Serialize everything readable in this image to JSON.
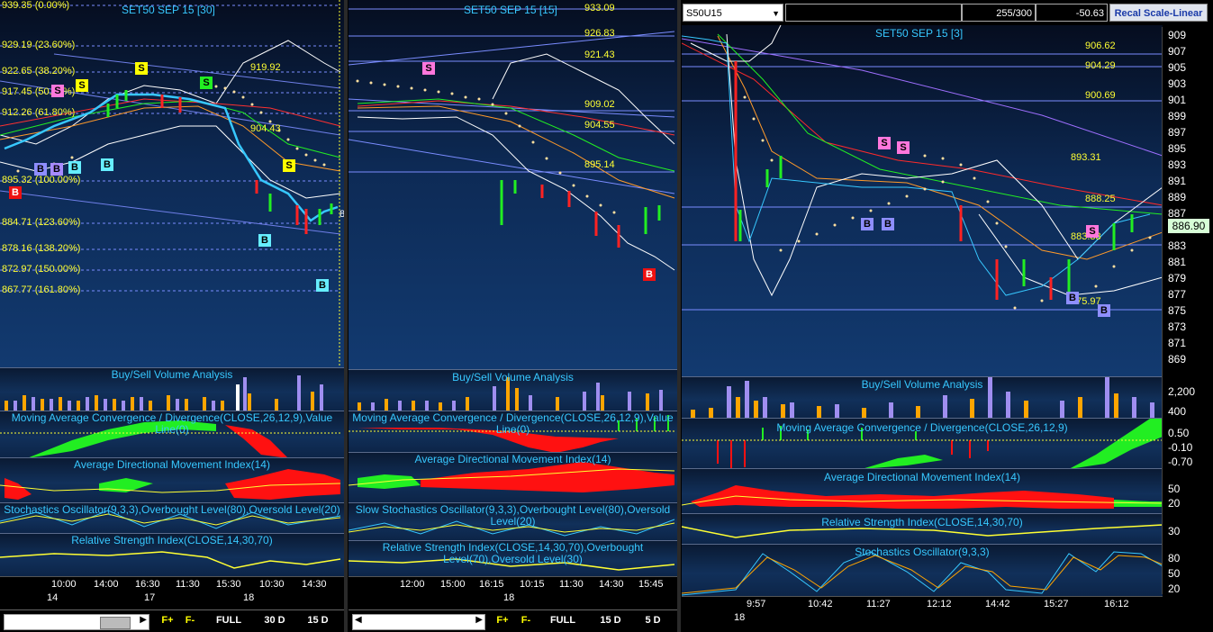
{
  "colors": {
    "accent": "#37c8ff",
    "level": "#ffff33",
    "bull": "#22ee22",
    "bear": "#ff1111",
    "volume_buy": "#ffa500",
    "volume_sell": "#9f8ef0"
  },
  "left": {
    "title": "SET50 SEP 15   [30]",
    "fib_levels": [
      "939.35 (0.00%)",
      "929.19 (23.60%)",
      "922.65 (38.20%)",
      "917.45 (50.00%)",
      "912.26 (61.80%)",
      "895.32 (100.00%)",
      "884.71 (123.60%)",
      "878.16 (138.20%)",
      "872.97 (150.00%)",
      "867.77 (161.80%)"
    ],
    "annotations": [
      "919.92",
      "904.43"
    ],
    "signals": [
      "S",
      "S",
      "S",
      "S",
      "B",
      "B",
      "B",
      "B",
      "B",
      "B",
      "B",
      "B",
      "S"
    ],
    "subcharts": [
      "Buy/Sell Volume Analysis",
      "Moving Average Convergence / Divergence(CLOSE,26,12,9),Value Line(0)",
      "Average Directional Movement Index(14)",
      "Stochastics Oscillator(9,3,3),Overbought Level(80),Oversold Level(20)",
      "Relative Strength Index(CLOSE,14,30,70)"
    ],
    "time_labels": [
      "10:00",
      "14:00",
      "16:30",
      "11:30",
      "15:30",
      "10:30",
      "14:30"
    ],
    "date_labels": [
      "14",
      "17",
      "18"
    ],
    "right_edge_label": "8",
    "bottom": {
      "fplus": "F+",
      "fminus": "F-",
      "full": "FULL",
      "r1": "30 D",
      "r2": "15 D"
    }
  },
  "mid": {
    "title": "SET50 SEP 15   [15]",
    "levels": [
      "933.09",
      "926.83",
      "921.43",
      "909.02",
      "904.55",
      "895.14"
    ],
    "signals": [
      "S",
      "B"
    ],
    "subcharts": [
      "Buy/Sell Volume Analysis",
      "Moving Average Convergence / Divergence(CLOSE,26,12,9),Value Line(0)",
      "Average Directional Movement Index(14)",
      "Slow Stochastics Oscillator(9,3,3),Overbought Level(80),Oversold Level(20)",
      "Relative Strength Index(CLOSE,14,30,70),Overbought Level(70),Oversold Level(30)"
    ],
    "time_labels": [
      "12:00",
      "15:00",
      "16:15",
      "10:15",
      "11:30",
      "14:30",
      "15:45"
    ],
    "date_labels": [
      "18"
    ],
    "bottom": {
      "fplus": "F+",
      "fminus": "F-",
      "full": "FULL",
      "r1": "15 D",
      "r2": "5 D"
    }
  },
  "right": {
    "symbol": "S50U15",
    "count": "255/300",
    "change": "-50.63",
    "scale_button": "Recal Scale-Linear",
    "title": "SET50 SEP 15   [3]",
    "levels": [
      "906.62",
      "904.29",
      "900.69",
      "893.31",
      "888.25",
      "883.33",
      "875.97"
    ],
    "last_price": "886.90",
    "price_axis": [
      "909",
      "907",
      "905",
      "903",
      "901",
      "899",
      "897",
      "895",
      "893",
      "891",
      "889",
      "887",
      "885",
      "883",
      "881",
      "879",
      "877",
      "875",
      "873",
      "871",
      "869"
    ],
    "vol_axis": [
      "2,200",
      "400"
    ],
    "macd_axis": [
      "0.50",
      "-0.10",
      "-0.70"
    ],
    "adx_axis": [
      "50",
      "20"
    ],
    "rsi_axis": [
      "30"
    ],
    "sto_axis": [
      "80",
      "50",
      "20"
    ],
    "signals": [
      "S",
      "S",
      "B",
      "B",
      "S",
      "B",
      "B"
    ],
    "subcharts": [
      "Buy/Sell Volume Analysis",
      "Moving Average Convergence / Divergence(CLOSE,26,12,9)",
      "Average Directional Movement Index(14)",
      "Relative Strength Index(CLOSE,14,30,70)",
      "Stochastics Oscillator(9,3,3)"
    ],
    "time_labels": [
      "9:57",
      "10:42",
      "11:27",
      "12:12",
      "14:42",
      "15:27",
      "16:12"
    ],
    "date_labels": [
      "18"
    ]
  }
}
